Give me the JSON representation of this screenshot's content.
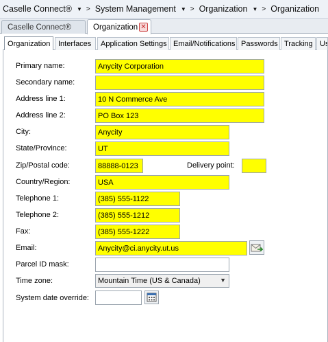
{
  "breadcrumb": {
    "items": [
      "Caselle Connect®",
      "System Management",
      "Organization",
      "Organization"
    ]
  },
  "doc_tabs": [
    {
      "label": "Caselle Connect®"
    },
    {
      "label": "Organization"
    }
  ],
  "section_tabs": [
    {
      "label": "Organization"
    },
    {
      "label": "Interfaces"
    },
    {
      "label": "Application Settings"
    },
    {
      "label": "Email/Notifications"
    },
    {
      "label": "Passwords"
    },
    {
      "label": "Tracking"
    },
    {
      "label": "Us"
    }
  ],
  "form": {
    "primary_name": {
      "label": "Primary name:",
      "value": "Anycity Corporation"
    },
    "secondary_name": {
      "label": "Secondary name:",
      "value": ""
    },
    "address1": {
      "label": "Address line 1:",
      "value": "10 N Commerce Ave"
    },
    "address2": {
      "label": "Address line 2:",
      "value": "PO Box 123"
    },
    "city": {
      "label": "City:",
      "value": "Anycity"
    },
    "state": {
      "label": "State/Province:",
      "value": "UT"
    },
    "zip": {
      "label": "Zip/Postal code:",
      "value": "88888-0123"
    },
    "delivery_point": {
      "label": "Delivery point:",
      "value": ""
    },
    "country": {
      "label": "Country/Region:",
      "value": "USA"
    },
    "telephone1": {
      "label": "Telephone 1:",
      "value": "(385) 555-1122"
    },
    "telephone2": {
      "label": "Telephone 2:",
      "value": "(385) 555-1212"
    },
    "fax": {
      "label": "Fax:",
      "value": "(385) 555-1222"
    },
    "email": {
      "label": "Email:",
      "value": "Anycity@ci.anycity.ut.us"
    },
    "parcel_id_mask": {
      "label": "Parcel ID mask:",
      "value": ""
    },
    "time_zone": {
      "label": "Time zone:",
      "value": "Mountain Time (US & Canada)"
    },
    "system_date_override": {
      "label": "System date override:",
      "value": ""
    }
  },
  "colors": {
    "required_highlight": "#ffff00",
    "close_icon": "#c62828"
  },
  "icons": {
    "email_send": "envelope-arrow-icon",
    "calendar": "calendar-icon",
    "close": "close-icon",
    "dropdown": "chevron-down-icon"
  }
}
